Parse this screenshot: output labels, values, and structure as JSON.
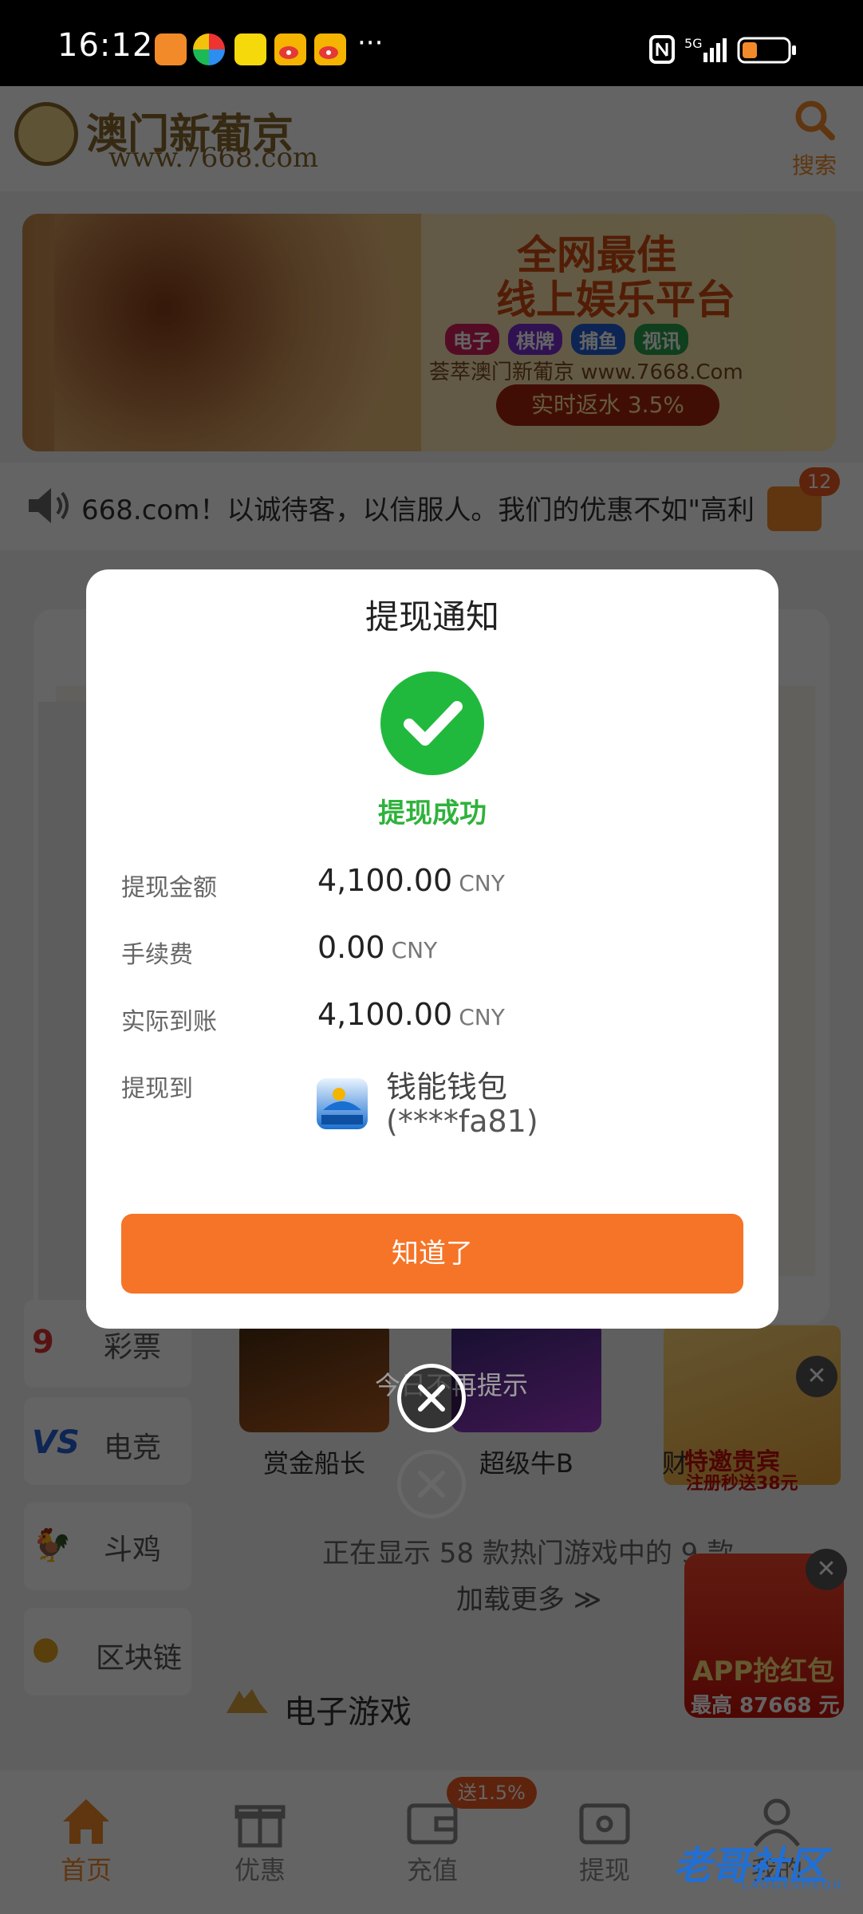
{
  "status_bar": {
    "time": "16:12",
    "more": "···",
    "network": "5G"
  },
  "header": {
    "logo_title": "澳门新葡京",
    "logo_url": "www.7668.com",
    "search_label": "搜索"
  },
  "banner": {
    "line1": "全网最佳",
    "line2": "线上娱乐平台",
    "tags": [
      "电子",
      "棋牌",
      "捕鱼",
      "视讯"
    ],
    "subtitle": "荟萃澳门新葡京 www.7668.Com",
    "rate": "实时返水 3.5%"
  },
  "marquee": {
    "text": "668.com！以诚待客，以信服人。我们的优惠不如\"高利",
    "badge": "12"
  },
  "categories": [
    {
      "label": "彩票",
      "icon": "9"
    },
    {
      "label": "电竞",
      "icon": "VS"
    },
    {
      "label": "斗鸡",
      "icon": "🐓"
    },
    {
      "label": "区块链",
      "icon": "●"
    }
  ],
  "games": [
    {
      "name": "赏金船长"
    },
    {
      "name": "超级牛B"
    },
    {
      "name": "财"
    }
  ],
  "promo": {
    "title": "特邀贵宾",
    "subtitle": "注册秒送38元"
  },
  "hot_games_text": "正在显示 58 款热门游戏中的 9 款",
  "load_more": "加载更多 ≫",
  "section_title": "电子游戏",
  "red_packet": {
    "title": "APP抢红包",
    "subtitle": "最高 87668 元"
  },
  "bottom_nav": {
    "items": [
      {
        "label": "首页",
        "active": true
      },
      {
        "label": "优惠",
        "active": false
      },
      {
        "label": "充值",
        "active": false
      },
      {
        "label": "提现",
        "active": false
      },
      {
        "label": "我的",
        "active": false
      }
    ],
    "recharge_badge": "送1.5%"
  },
  "watermark": {
    "text": "老哥社区",
    "sub": "LAOGESHEQU"
  },
  "notice_overlay": {
    "dont_show_today": "今日不再提示"
  },
  "modal": {
    "title": "提现通知",
    "status": "提现成功",
    "rows": [
      {
        "label": "提现金额",
        "value": "4,100.00",
        "unit": "CNY"
      },
      {
        "label": "手续费",
        "value": "0.00",
        "unit": "CNY"
      },
      {
        "label": "实际到账",
        "value": "4,100.00",
        "unit": "CNY"
      }
    ],
    "destination_label": "提现到",
    "wallet_name": "钱能钱包",
    "wallet_account": "(****fa81)",
    "wallet_icon_text": "钱能钱包",
    "confirm_button": "知道了"
  },
  "colors": {
    "accent": "#f57427",
    "success": "#21b93d",
    "status_bar_bg": "#000000",
    "brand_gold": "#8a6a2e"
  }
}
